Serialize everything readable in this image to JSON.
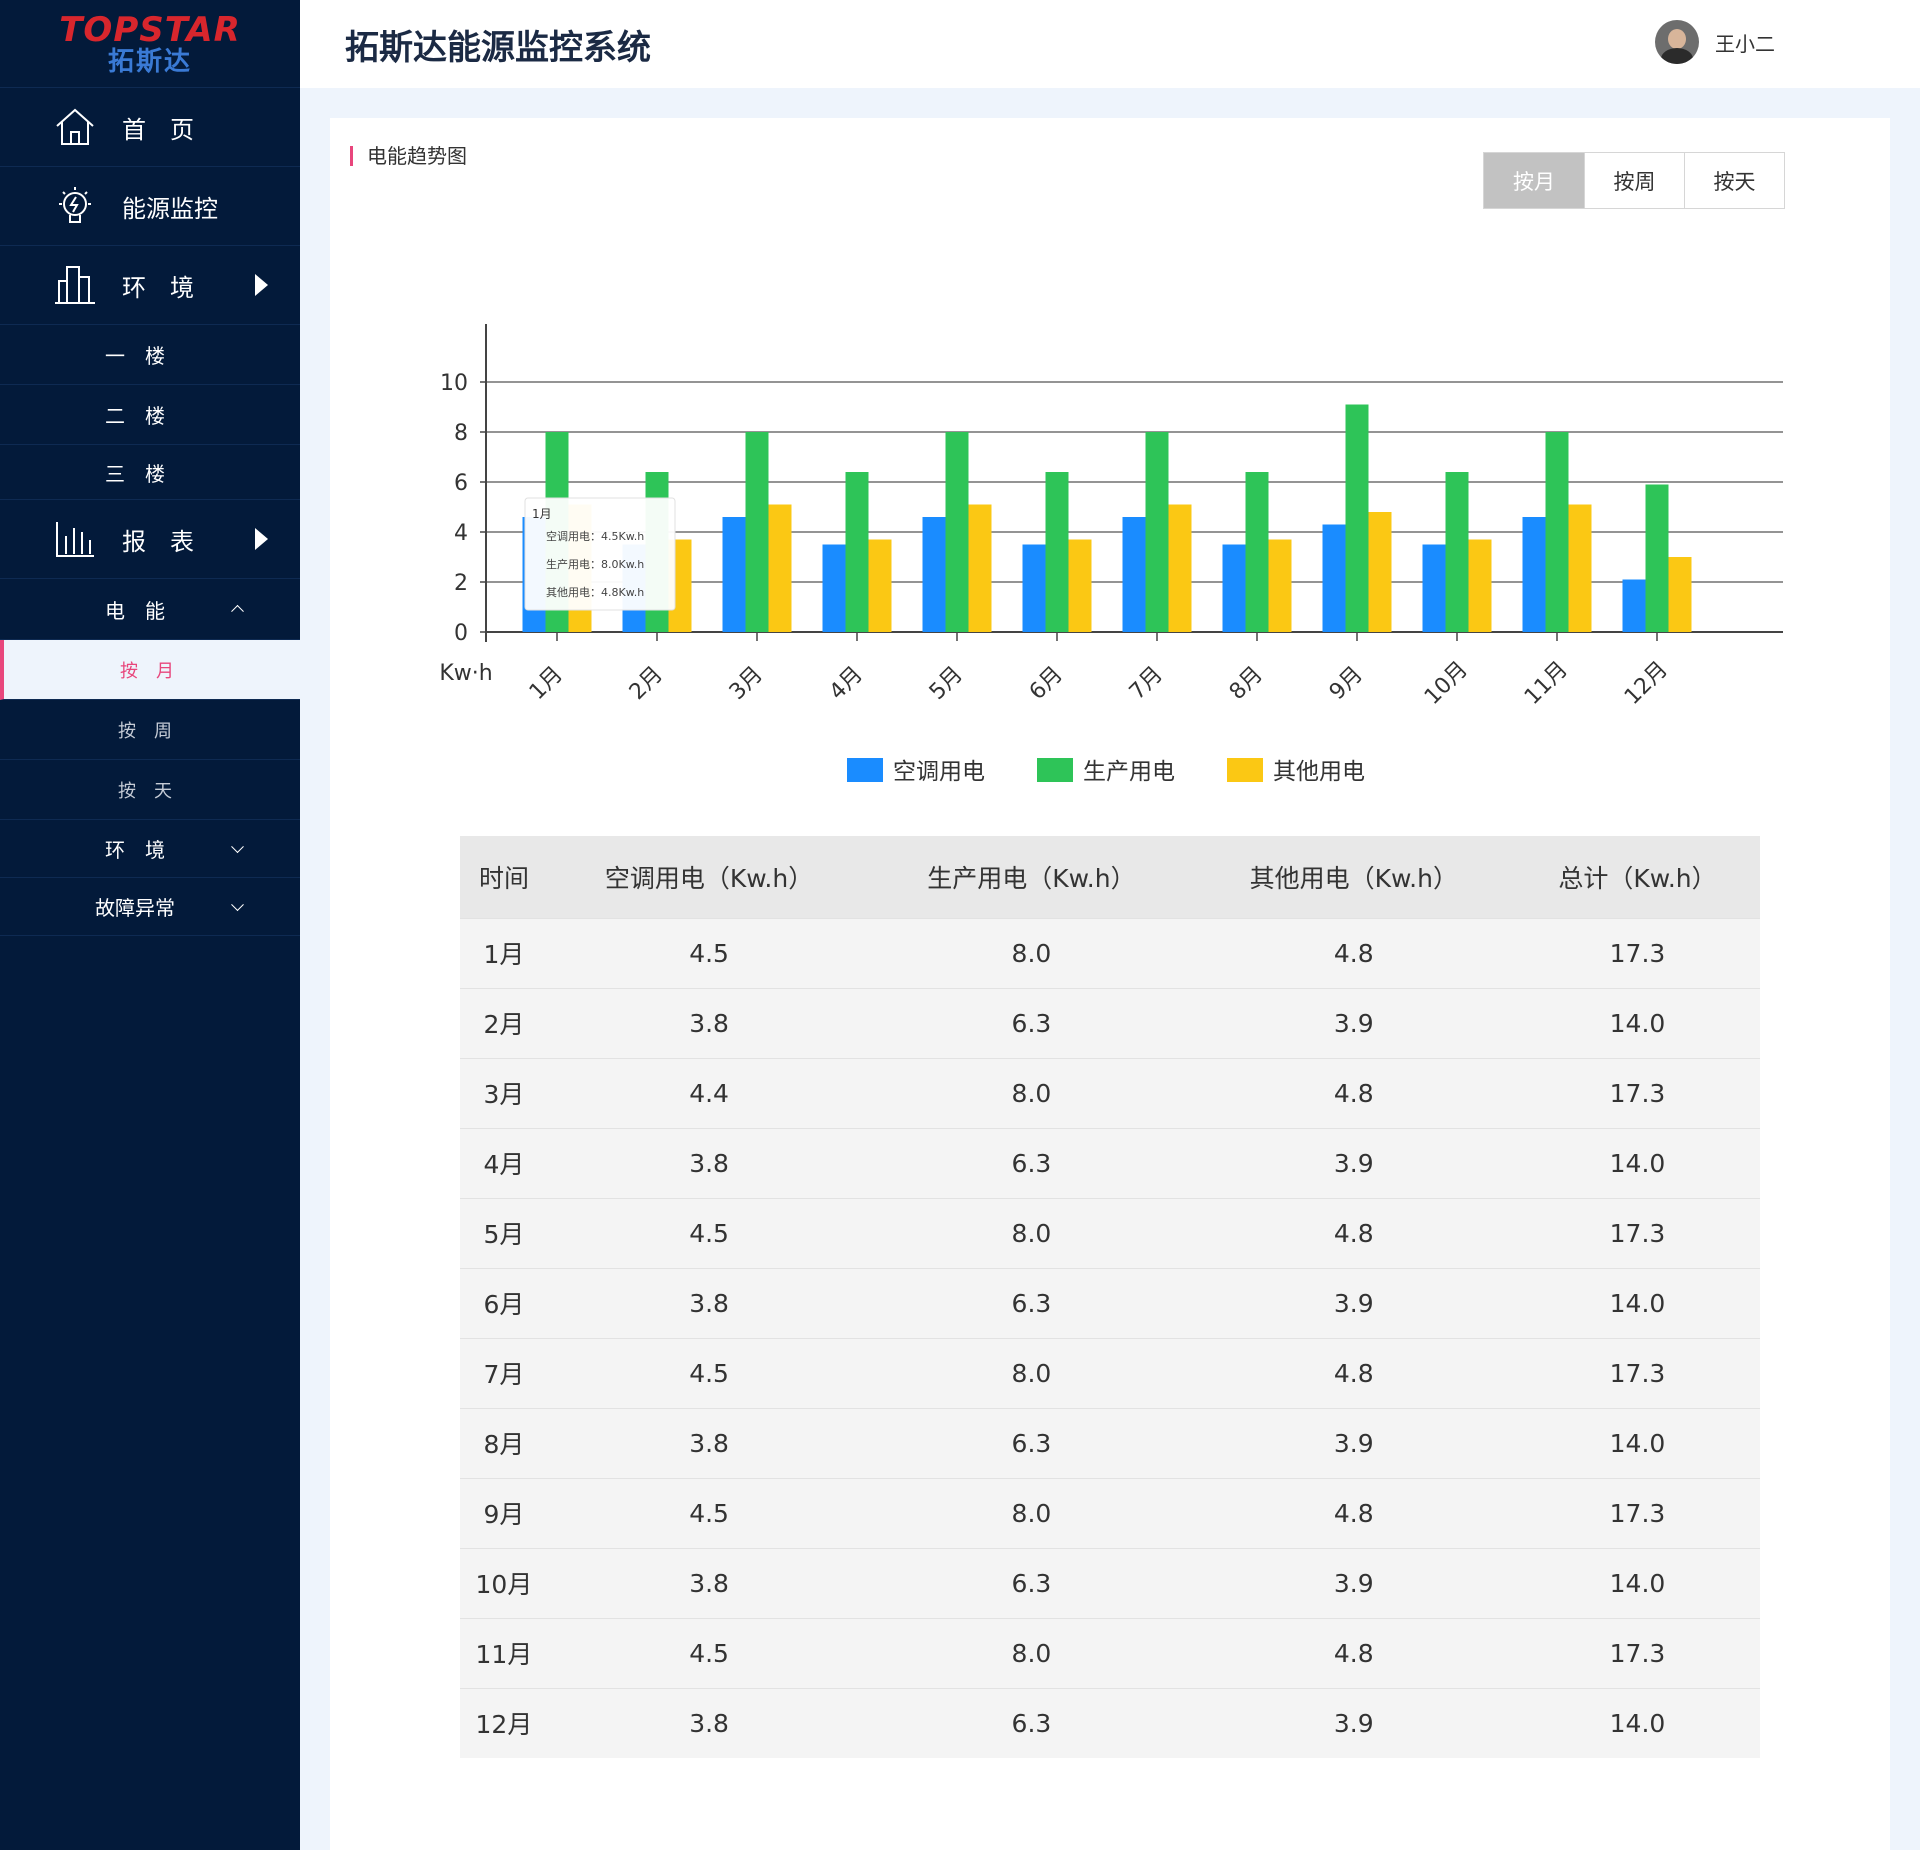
{
  "brand": {
    "logo_en": "TOPSTAR",
    "logo_cn": "拓斯达"
  },
  "header": {
    "title": "拓斯达能源监控系统",
    "user_name": "王小二"
  },
  "sidebar": {
    "home": "首　页",
    "energy": "能源监控",
    "env": "环　境",
    "floors": [
      "一　楼",
      "二　楼",
      "三　楼"
    ],
    "report": "报　表",
    "power": "电　能",
    "power_items": [
      "按　月",
      "按　周",
      "按　天"
    ],
    "report_env": "环　境",
    "fault": "故障异常"
  },
  "card": {
    "title": "电能趋势图",
    "segments": [
      "按月",
      "按周",
      "按天"
    ],
    "active_segment": 0
  },
  "chart_data": {
    "type": "bar",
    "ylabel": "Kw·h",
    "ylim": [
      0,
      10
    ],
    "yticks": [
      0,
      2,
      4,
      6,
      8,
      10
    ],
    "categories": [
      "1月",
      "2月",
      "3月",
      "4月",
      "5月",
      "6月",
      "7月",
      "8月",
      "9月",
      "10月",
      "11月",
      "12月"
    ],
    "series": [
      {
        "name": "空调用电",
        "color": "#1a8cff",
        "values": [
          4.6,
          3.5,
          4.6,
          3.5,
          4.6,
          3.5,
          4.6,
          3.5,
          4.3,
          3.5,
          4.6,
          2.1
        ]
      },
      {
        "name": "生产用电",
        "color": "#2ec458",
        "values": [
          8.0,
          6.4,
          8.0,
          6.4,
          8.0,
          6.4,
          8.0,
          6.4,
          9.1,
          6.4,
          8.0,
          5.9
        ]
      },
      {
        "name": "其他用电",
        "color": "#fbc814",
        "values": [
          5.1,
          3.7,
          5.1,
          3.7,
          5.1,
          3.7,
          5.1,
          3.7,
          4.8,
          3.7,
          5.1,
          3.0
        ]
      }
    ],
    "legend": "bottom-center",
    "grid": true,
    "tooltip": {
      "title": "1月",
      "lines": [
        "空调用电：4.5Kw.h",
        "生产用电：8.0Kw.h",
        "其他用电：4.8Kw.h"
      ]
    }
  },
  "table": {
    "headers": [
      "时间",
      "空调用电（Kw.h）",
      "生产用电（Kw.h）",
      "其他用电（Kw.h）",
      "总计（Kw.h）"
    ],
    "rows": [
      [
        "1月",
        "4.5",
        "8.0",
        "4.8",
        "17.3"
      ],
      [
        "2月",
        "3.8",
        "6.3",
        "3.9",
        "14.0"
      ],
      [
        "3月",
        "4.4",
        "8.0",
        "4.8",
        "17.3"
      ],
      [
        "4月",
        "3.8",
        "6.3",
        "3.9",
        "14.0"
      ],
      [
        "5月",
        "4.5",
        "8.0",
        "4.8",
        "17.3"
      ],
      [
        "6月",
        "3.8",
        "6.3",
        "3.9",
        "14.0"
      ],
      [
        "7月",
        "4.5",
        "8.0",
        "4.8",
        "17.3"
      ],
      [
        "8月",
        "3.8",
        "6.3",
        "3.9",
        "14.0"
      ],
      [
        "9月",
        "4.5",
        "8.0",
        "4.8",
        "17.3"
      ],
      [
        "10月",
        "3.8",
        "6.3",
        "3.9",
        "14.0"
      ],
      [
        "11月",
        "4.5",
        "8.0",
        "4.8",
        "17.3"
      ],
      [
        "12月",
        "3.8",
        "6.3",
        "3.9",
        "14.0"
      ]
    ]
  }
}
